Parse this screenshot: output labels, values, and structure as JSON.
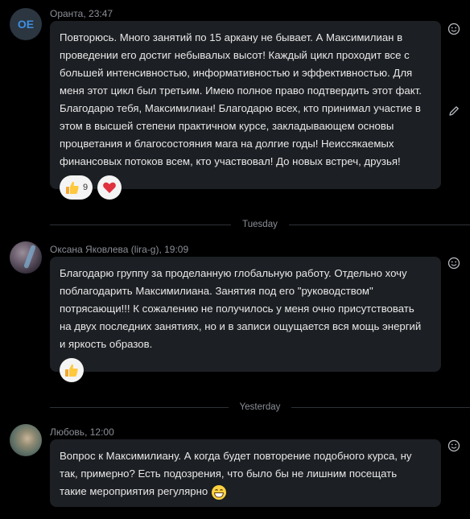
{
  "messages": [
    {
      "author": "Оранта",
      "time": "23:47",
      "avatar_initials": "ОЕ",
      "text": "Повторюсь. Много занятий по 15 аркану не бывает. А Максимилиан в\nпроведении его достиг небывалых высот! Каждый цикл проходит все с\nбольшей интенсивностью, информативностью  и эффективностью. Для\nменя этот цикл был третьим. Имею полное право подтвердить этот факт.\nБлагодарю тебя, Максимилиан!  Благодарю всех, кто принимал участие в\nэтом в высшей степени практичном курсе, закладывающем основы\nпроцветания и благосостояния мага на долгие годы! Неиссякаемых\nфинансовых потоков всем, кто участвовал! До новых встреч, друзья!",
      "reactions": [
        {
          "icon": "thumbs-up-icon",
          "count": "9"
        },
        {
          "icon": "heart-icon",
          "count": ""
        }
      ]
    },
    {
      "author": "Оксана Яковлева (lira-g)",
      "time": "19:09",
      "text": "Благодарю группу за проделанную глобальную работу. Отдельно хочу\nпоблагодарить Максимилиана. Занятия под его \"руководством\"\nпотрясающи!!! К сожалению не получилось у меня очно присутствовать\nна двух последних занятиях, но и в записи ощущается вся мощь энергий\nи яркость образов.",
      "reactions": [
        {
          "icon": "thumbs-up-icon",
          "count": ""
        }
      ]
    },
    {
      "author": "Любовь",
      "time": "12:00",
      "text": "Вопрос к Максимилиану. А когда будет повторение подобного курса, ну\nтак, примерно? Есть подозрения, что было бы не лишним посещать\nтакие мероприятия регулярно",
      "trailing_emoji": "grinning-face-icon"
    }
  ],
  "dividers": [
    "Tuesday",
    "Yesterday"
  ],
  "colors": {
    "background": "#000000",
    "bubble": "#1c1f23",
    "meta_text": "#8a8f96",
    "accent": "#3e8fe0",
    "heart": "#e0313f"
  }
}
